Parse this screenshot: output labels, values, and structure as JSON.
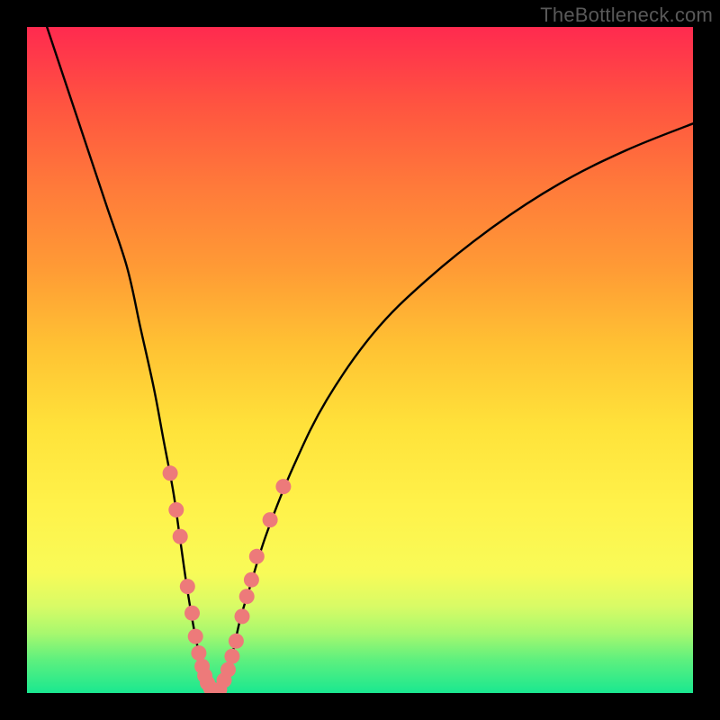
{
  "watermark": "TheBottleneck.com",
  "chart_data": {
    "type": "line",
    "title": "",
    "xlabel": "",
    "ylabel": "",
    "xlim": [
      0,
      100
    ],
    "ylim": [
      0,
      100
    ],
    "series": [
      {
        "name": "curve-left",
        "x": [
          3,
          6,
          9,
          12,
          15,
          17,
          19,
          20.5,
          22,
          23,
          24,
          25,
          25.8,
          26.2,
          26.5,
          27,
          27.5,
          28.5
        ],
        "values": [
          100,
          91,
          82,
          73,
          64,
          55,
          46,
          38,
          30,
          23,
          16,
          10,
          6,
          4,
          2.5,
          1.5,
          0.7,
          0.2
        ]
      },
      {
        "name": "curve-right",
        "x": [
          28.5,
          29,
          29.5,
          30,
          31,
          32,
          33.5,
          36,
          40,
          45,
          52,
          60,
          70,
          80,
          90,
          100
        ],
        "values": [
          0.2,
          0.7,
          1.6,
          3,
          6.5,
          11,
          16,
          24,
          34,
          44,
          54,
          62,
          70,
          76.5,
          81.5,
          85.5
        ]
      }
    ],
    "markers": [
      {
        "series": "curve-left",
        "x": 21.5,
        "y": 33
      },
      {
        "series": "curve-left",
        "x": 22.4,
        "y": 27.5
      },
      {
        "series": "curve-left",
        "x": 23.0,
        "y": 23.5
      },
      {
        "series": "curve-left",
        "x": 24.1,
        "y": 16
      },
      {
        "series": "curve-left",
        "x": 24.8,
        "y": 12
      },
      {
        "series": "curve-left",
        "x": 25.3,
        "y": 8.5
      },
      {
        "series": "curve-left",
        "x": 25.8,
        "y": 6
      },
      {
        "series": "curve-left",
        "x": 26.3,
        "y": 4
      },
      {
        "series": "curve-left",
        "x": 26.7,
        "y": 2.6
      },
      {
        "series": "curve-left",
        "x": 27.1,
        "y": 1.5
      },
      {
        "series": "curve-left",
        "x": 27.6,
        "y": 0.7
      },
      {
        "series": "curve-left",
        "x": 28.2,
        "y": 0.3
      },
      {
        "series": "curve-right",
        "x": 28.9,
        "y": 0.5
      },
      {
        "series": "curve-right",
        "x": 29.6,
        "y": 1.9
      },
      {
        "series": "curve-right",
        "x": 30.2,
        "y": 3.5
      },
      {
        "series": "curve-right",
        "x": 30.8,
        "y": 5.5
      },
      {
        "series": "curve-right",
        "x": 31.4,
        "y": 7.8
      },
      {
        "series": "curve-right",
        "x": 32.3,
        "y": 11.5
      },
      {
        "series": "curve-right",
        "x": 33.0,
        "y": 14.5
      },
      {
        "series": "curve-right",
        "x": 33.7,
        "y": 17
      },
      {
        "series": "curve-right",
        "x": 34.5,
        "y": 20.5
      },
      {
        "series": "curve-right",
        "x": 36.5,
        "y": 26
      },
      {
        "series": "curve-right",
        "x": 38.5,
        "y": 31
      }
    ],
    "colors": {
      "curve_stroke": "#000000",
      "marker_fill": "#ed7a7a",
      "background_top": "#ff2a4f",
      "background_bottom": "#1ae890"
    }
  }
}
